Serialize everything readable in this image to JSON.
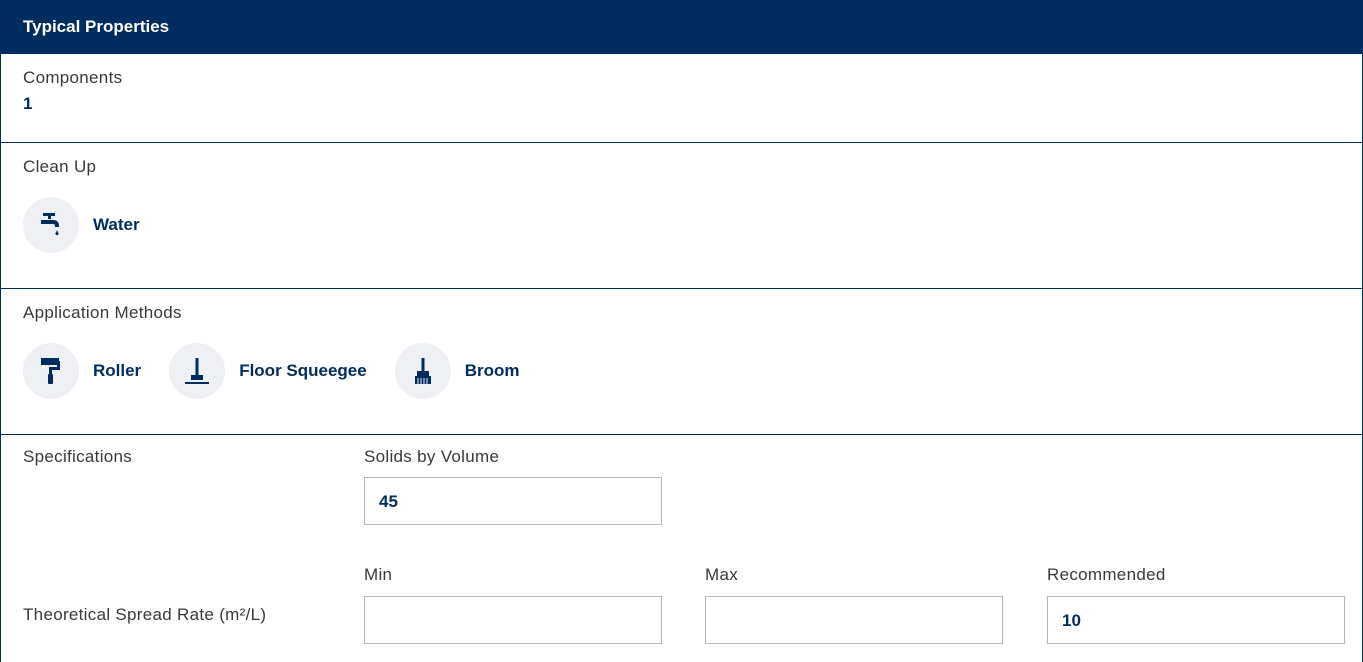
{
  "header": {
    "title": "Typical Properties"
  },
  "components": {
    "label": "Components",
    "value": "1"
  },
  "clean_up": {
    "label": "Clean Up",
    "items": [
      {
        "icon": "water-tap-icon",
        "label": "Water"
      }
    ]
  },
  "application_methods": {
    "label": "Application Methods",
    "items": [
      {
        "icon": "roller-icon",
        "label": "Roller"
      },
      {
        "icon": "floor-squeegee-icon",
        "label": "Floor Squeegee"
      },
      {
        "icon": "broom-icon",
        "label": "Broom"
      }
    ]
  },
  "specifications": {
    "label": "Specifications",
    "solids_by_volume": {
      "label": "Solids by Volume",
      "value": "45"
    },
    "spread_rate": {
      "label": "Theoretical Spread Rate (m²/L)",
      "min": {
        "label": "Min",
        "value": ""
      },
      "max": {
        "label": "Max",
        "value": ""
      },
      "recommended": {
        "label": "Recommended",
        "value": "10"
      }
    }
  },
  "colors": {
    "brand": "#002c5f",
    "icon_bg": "#eef0f3"
  }
}
